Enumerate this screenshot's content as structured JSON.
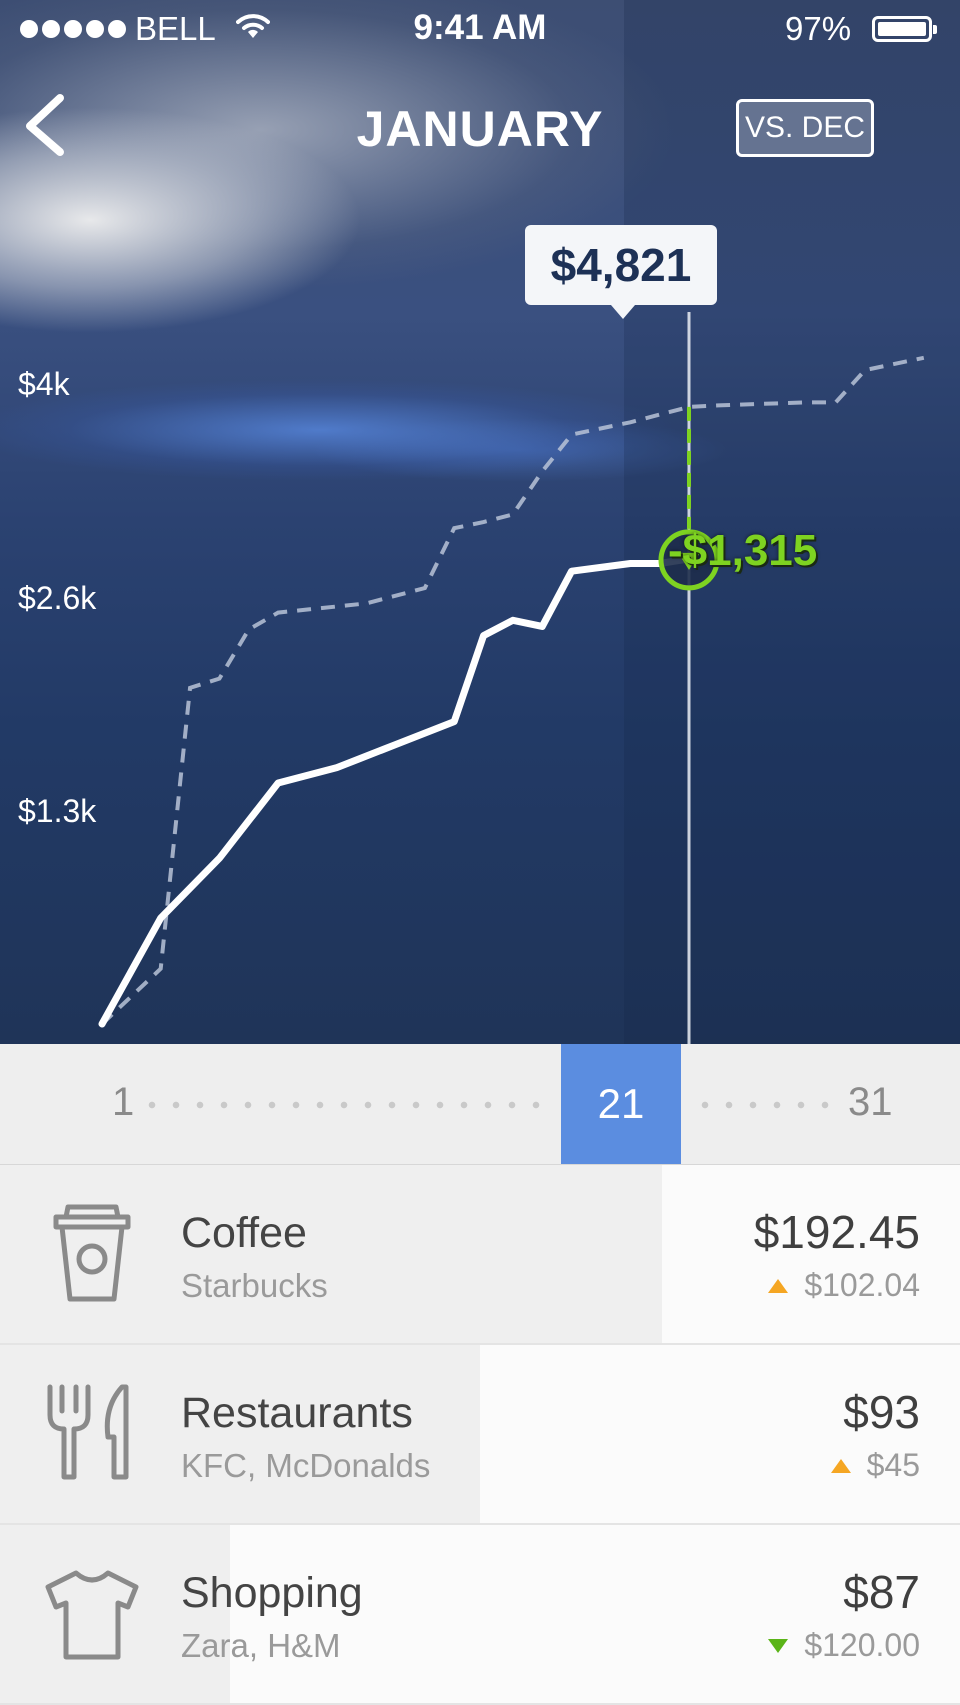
{
  "status_bar": {
    "carrier": "BELL",
    "time": "9:41 AM",
    "battery": "97%"
  },
  "header": {
    "title": "JANUARY",
    "compare_button": "VS. DEC"
  },
  "icons": {
    "back": "chevron-left-icon",
    "wifi": "wifi-icon",
    "battery": "battery-icon",
    "coffee": "coffee-cup-icon",
    "restaurants": "fork-knife-icon",
    "shopping": "tshirt-icon"
  },
  "colors": {
    "accent_blue": "#5b8de0",
    "positive_green": "#7ed321",
    "increase_orange": "#f5a623",
    "decrease_green": "#5bb418"
  },
  "chart_data": {
    "type": "line",
    "title": "JANUARY",
    "y_tick_labels": [
      "$4k",
      "$2.6k",
      "$1.3k"
    ],
    "y_ticks": [
      4000,
      2600,
      1300
    ],
    "ylim": [
      0,
      5000
    ],
    "xlim": [
      1,
      31
    ],
    "series": [
      {
        "name": "",
        "style": "solid",
        "x": [
          1,
          3,
          5,
          7,
          9,
          11,
          13,
          14,
          15,
          16,
          17,
          19,
          20,
          21
        ],
        "values": [
          0,
          690,
          1080,
          1570,
          1670,
          1820,
          1970,
          2530,
          2630,
          2590,
          2950,
          3000,
          3000,
          3030
        ]
      },
      {
        "name": "",
        "style": "dashed",
        "x": [
          1,
          3,
          4,
          5,
          6,
          7,
          8,
          9,
          10,
          12,
          13,
          14,
          15,
          16,
          17,
          19,
          21,
          22,
          25,
          26,
          27,
          29
        ],
        "values": [
          0,
          360,
          2190,
          2250,
          2570,
          2680,
          2700,
          2720,
          2740,
          2840,
          3230,
          3270,
          3320,
          3600,
          3840,
          3920,
          4020,
          4030,
          4050,
          4050,
          4260,
          4340
        ]
      }
    ],
    "selected_day": 21,
    "selected_value_label": "$4,821",
    "difference_label": "-$1,315"
  },
  "scrubber": {
    "start": "1",
    "current": "21",
    "end": "31"
  },
  "categories": [
    {
      "name": "Coffee",
      "merchants": "Starbucks",
      "amount": "$192.45",
      "change": "$102.04",
      "direction": "up",
      "progress": 0.69
    },
    {
      "name": "Restaurants",
      "merchants": "KFC, McDonalds",
      "amount": "$93",
      "change": "$45",
      "direction": "up",
      "progress": 0.5
    },
    {
      "name": "Shopping",
      "merchants": "Zara, H&M",
      "amount": "$87",
      "change": "$120.00",
      "direction": "down",
      "progress": 0.24
    }
  ]
}
